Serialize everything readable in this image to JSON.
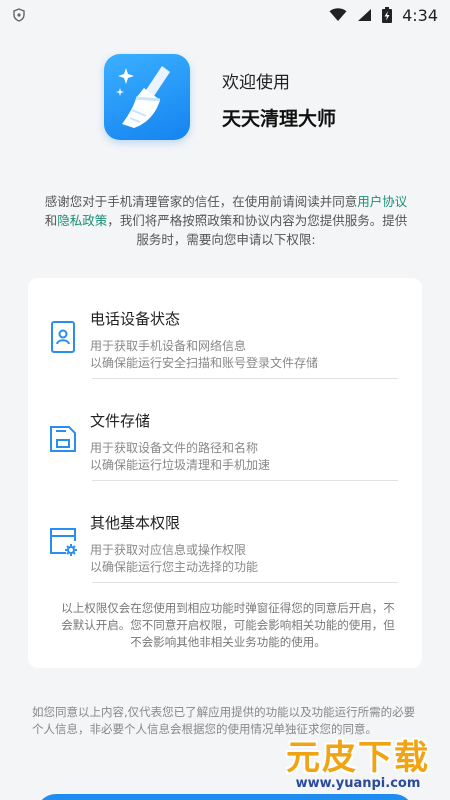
{
  "status_bar": {
    "time": "4:34",
    "icons": [
      "shield-icon",
      "wifi-icon",
      "signal-icon",
      "battery-charging-icon"
    ]
  },
  "header": {
    "welcome": "欢迎使用",
    "app_name": "天天清理大师",
    "icon": "broom-icon",
    "accent_color": "#1f8df0"
  },
  "intro": {
    "part1": "感谢您对于手机清理管家的信任，在使用前请阅读并同意",
    "user_agreement": "用户协议",
    "and": "和",
    "privacy_policy": "隐私政策",
    "part2": "，我们将严格按照政策和协议内容为您提供服务。提供服务时，需要向您申请以下权限:",
    "link_color": "#1a8f74"
  },
  "permissions": [
    {
      "title": "电话设备状态",
      "desc1": "用于获取手机设备和网络信息",
      "desc2": "以确保能运行安全扫描和账号登录文件存储",
      "icon": "phone-id-icon"
    },
    {
      "title": "文件存储",
      "desc1": "用于获取设备文件的路径和名称",
      "desc2": "以确保能运行垃圾清理和手机加速",
      "icon": "storage-icon"
    },
    {
      "title": "其他基本权限",
      "desc1": "用于获取对应信息或操作权限",
      "desc2": "以确保能运行您主动选择的功能",
      "icon": "settings-window-icon"
    }
  ],
  "note": "以上权限仅会在您使用到相应功能时弹窗征得您的同意后开启，不会默认开启。您不同意开启权限，可能会影响相关功能的使用，但不会影响其他非相关业务功能的使用。",
  "footer": "如您同意以上内容,仅代表您已了解应用提供的功能以及功能运行所需的必要个人信息，非必要个人信息会根据您的使用情况单独征求您的同意。",
  "watermark": {
    "text": "元皮下载",
    "url": "www.yuanpi.com"
  }
}
